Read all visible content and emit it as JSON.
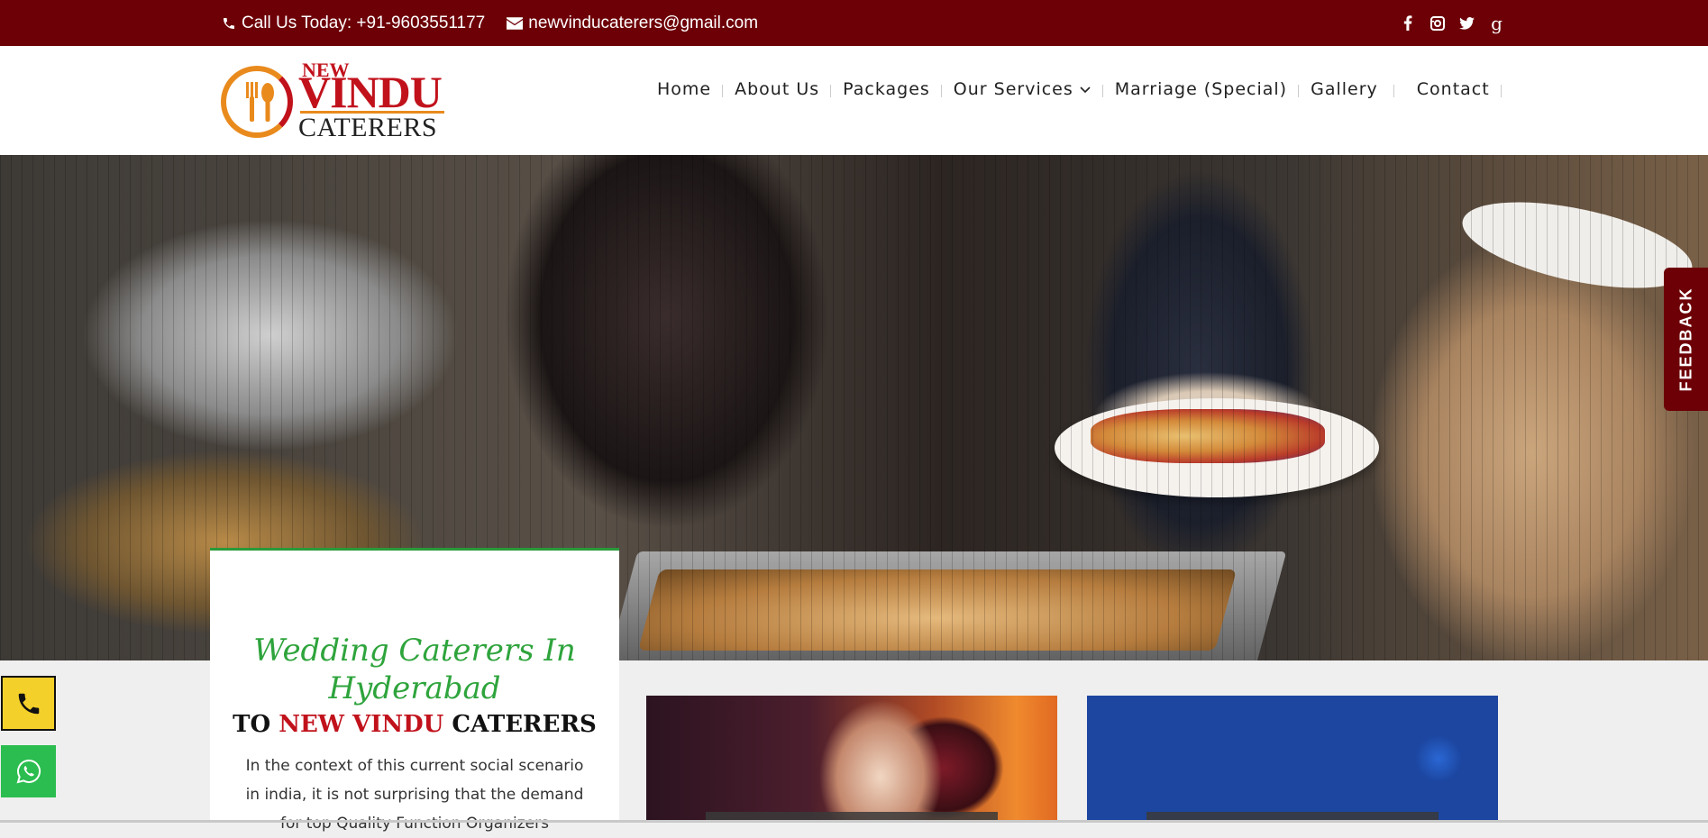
{
  "topbar": {
    "phone_label": "Call Us Today: +91-9603551177",
    "email": "newvinducaterers@gmail.com",
    "social": [
      "facebook-icon",
      "instagram-icon",
      "twitter-icon",
      "google-plus-icon"
    ]
  },
  "logo": {
    "line1": "NEW",
    "line2": "VINDU",
    "line3": "CATERERS"
  },
  "nav": {
    "items": [
      "Home",
      "About Us",
      "Packages",
      "Our Services",
      "Marriage (Special)",
      "Gallery",
      "Contact"
    ]
  },
  "feedback": {
    "label": "FEEDBACK"
  },
  "card": {
    "heading": "Wedding Caterers In Hyderabad",
    "to_prefix": "TO ",
    "brand": "NEW VINDU",
    "to_suffix": " CATERERS",
    "body": "In the context of this current social scenario in india, it is not surprising that the demand for top Quality Function Organizers"
  },
  "colors": {
    "brand_maroon": "#6d0007",
    "brand_red": "#c1121c",
    "script_green": "#2ea43c",
    "call_yellow": "#f4d02a",
    "whatsapp_green": "#2bbd4f"
  }
}
